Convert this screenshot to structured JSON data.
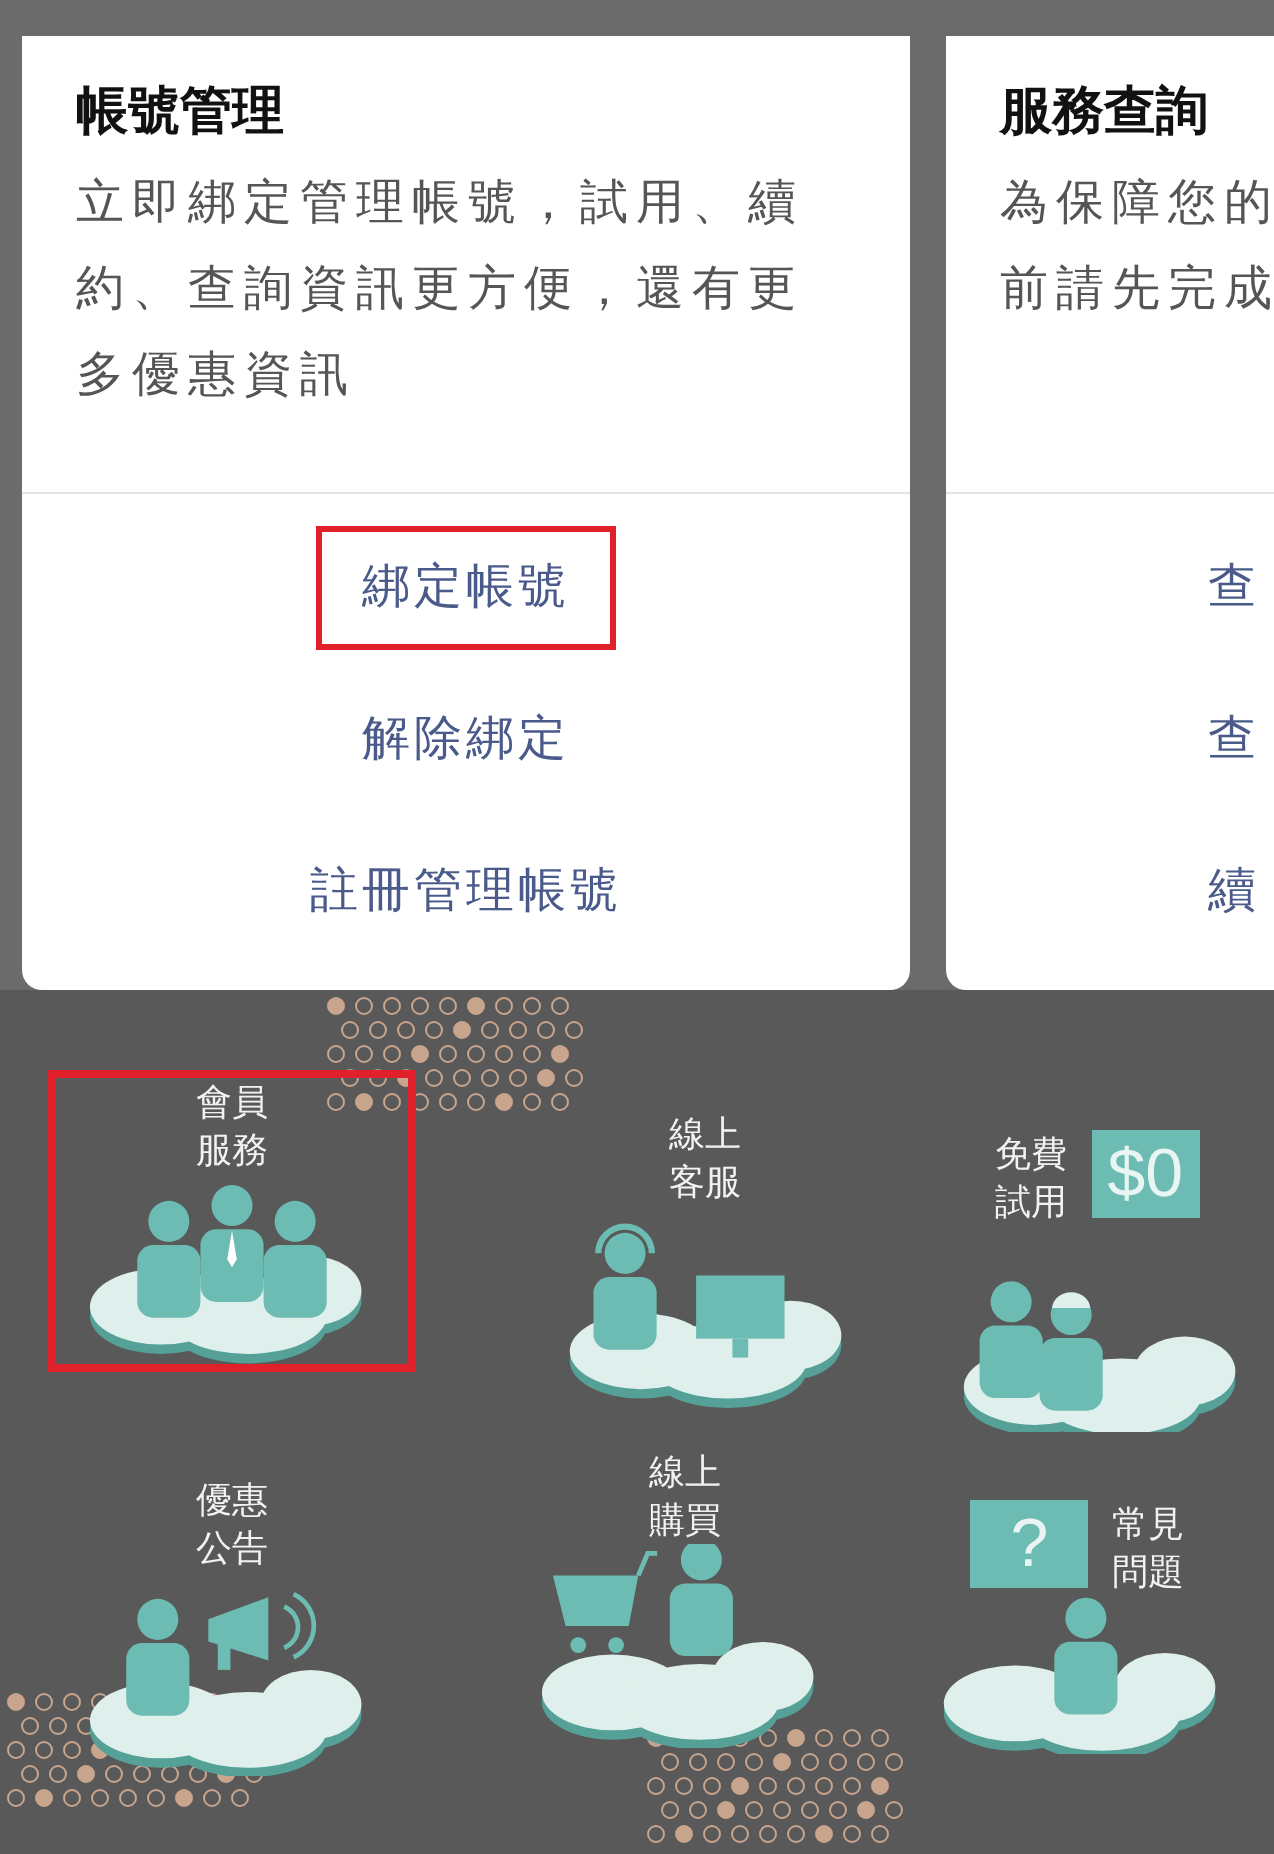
{
  "cards": [
    {
      "title": "帳號管理",
      "body_lines": [
        "立即綁定管理帳號，試用、續約、查詢資訊更方便，還有更多優惠資訊"
      ],
      "actions": [
        {
          "label": "綁定帳號",
          "highlighted": true
        },
        {
          "label": "解除綁定",
          "highlighted": false
        },
        {
          "label": "註冊管理帳號",
          "highlighted": false
        }
      ]
    },
    {
      "title": "服務查詢",
      "body_lines": [
        "為保障您的",
        "前請先完成"
      ],
      "actions": [
        {
          "label": "查",
          "highlighted": false
        },
        {
          "label": "查",
          "highlighted": false
        },
        {
          "label": "續",
          "highlighted": false
        }
      ]
    }
  ],
  "services": [
    {
      "kind": "members",
      "label_lines": [
        "會員",
        "服務"
      ],
      "highlighted": true
    },
    {
      "kind": "support",
      "label_lines": [
        "線上",
        "客服"
      ],
      "highlighted": false
    },
    {
      "kind": "trial",
      "label_lines": [
        "免費",
        "試用"
      ],
      "badge": "$0",
      "highlighted": false
    },
    {
      "kind": "offers",
      "label_lines": [
        "優惠",
        "公告"
      ],
      "highlighted": false
    },
    {
      "kind": "purchase",
      "label_lines": [
        "線上",
        "購買"
      ],
      "highlighted": false
    },
    {
      "kind": "faq",
      "label_lines": [
        "常見",
        "問題"
      ],
      "badge": "?",
      "highlighted": false
    }
  ]
}
